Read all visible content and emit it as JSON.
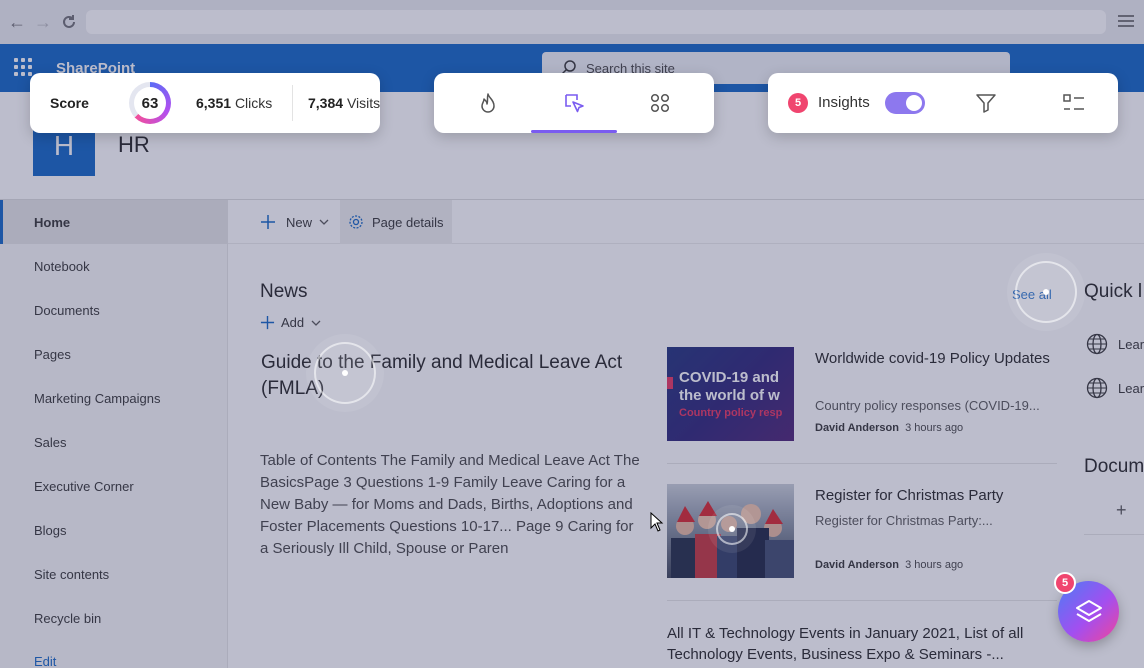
{
  "suite_bar": {
    "brand": "SharePoint",
    "search_placeholder": "Search this site"
  },
  "site": {
    "logo_letter": "H",
    "title": "HR"
  },
  "left_nav": {
    "items": [
      {
        "label": "Home",
        "active": true
      },
      {
        "label": "Notebook"
      },
      {
        "label": "Documents"
      },
      {
        "label": "Pages"
      },
      {
        "label": "Marketing Campaigns"
      },
      {
        "label": "Sales"
      },
      {
        "label": "Executive Corner"
      },
      {
        "label": "Blogs"
      },
      {
        "label": "Site contents"
      },
      {
        "label": "Recycle bin"
      },
      {
        "label": "Edit"
      }
    ]
  },
  "command_bar": {
    "new_label": "New",
    "page_details_label": "Page details"
  },
  "news": {
    "heading": "News",
    "add_label": "Add",
    "see_all": "See all",
    "feature": {
      "title": "Guide to the Family and Medical Leave Act (FMLA)",
      "description": "Table of Contents The Family and Medical Leave Act The BasicsPage 3 Questions 1-9 Family Leave Caring for a New Baby — for Moms and Dads, Births, Adoptions and Foster Placements Questions 10-17... Page 9 Caring for a Seriously Ill Child, Spouse or Paren"
    },
    "items": [
      {
        "title": "Worldwide covid-19 Policy Updates",
        "subtitle": "Country policy responses (COVID-19...",
        "author": "David Anderson",
        "time": "3 hours ago",
        "thumb_text_1": "COVID-19 and",
        "thumb_text_2": "the world of w",
        "thumb_text_3": "Country policy resp"
      },
      {
        "title": "Register for Christmas Party",
        "subtitle": "Register for Christmas Party:...",
        "author": "David Anderson",
        "time": "3 hours ago"
      }
    ],
    "event_title": "All IT & Technology Events in January 2021, List of all Technology Events, Business Expo & Seminars -..."
  },
  "right_column": {
    "quick_links_heading": "Quick l",
    "quick_links": [
      "Lear",
      "Lear"
    ],
    "documents_heading": "Docum"
  },
  "analytics": {
    "score_label": "Score",
    "score_value": "63",
    "score_fraction": 0.63,
    "clicks_value": "6,351",
    "clicks_label": "Clicks",
    "visits_value": "7,384",
    "visits_label": "Visits",
    "insights_badge": "5",
    "insights_label": "Insights",
    "insights_enabled": true,
    "fab_badge": "5",
    "colors": {
      "accent": "#7a5cf0",
      "badge": "#f0456f",
      "sharepoint_blue": "#0f63c4"
    },
    "icons": [
      "flame-icon",
      "click-cursor-icon",
      "grid-icon",
      "filter-icon",
      "list-icon",
      "layers-icon"
    ]
  }
}
